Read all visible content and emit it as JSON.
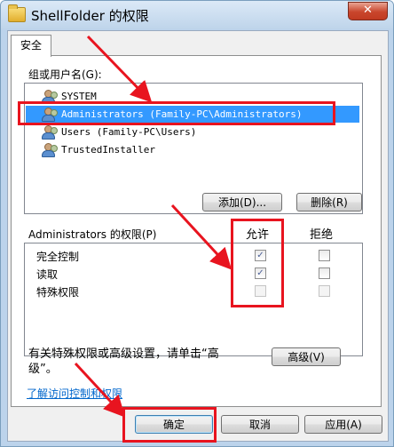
{
  "window": {
    "title": "ShellFolder 的权限",
    "close_glyph": "✕",
    "icon": "folder-icon"
  },
  "tabs": [
    {
      "label": "安全"
    }
  ],
  "groups": {
    "label": "组或用户名(G):",
    "items": [
      {
        "name": "SYSTEM",
        "selected": false
      },
      {
        "name": "Administrators (Family-PC\\Administrators)",
        "selected": true
      },
      {
        "name": "Users (Family-PC\\Users)",
        "selected": false
      },
      {
        "name": "TrustedInstaller",
        "selected": false
      }
    ],
    "add_label": "添加(D)...",
    "remove_label": "删除(R)"
  },
  "permissions": {
    "label": "Administrators 的权限(P)",
    "allow_header": "允许",
    "deny_header": "拒绝",
    "rows": [
      {
        "name": "完全控制",
        "allow": true,
        "deny": false
      },
      {
        "name": "读取",
        "allow": true,
        "deny": false
      },
      {
        "name": "特殊权限",
        "allow": false,
        "deny": false
      }
    ],
    "check_glyph": "✓"
  },
  "advanced": {
    "text_line1": "有关特殊权限或高级设置，请单击“高",
    "text_line2": "级”。",
    "button_label": "高级(V)"
  },
  "link": {
    "label": "了解访问控制和权限"
  },
  "footer": {
    "ok_label": "确定",
    "cancel_label": "取消",
    "apply_label": "应用(A)"
  },
  "annotation_color": "#e8141f"
}
